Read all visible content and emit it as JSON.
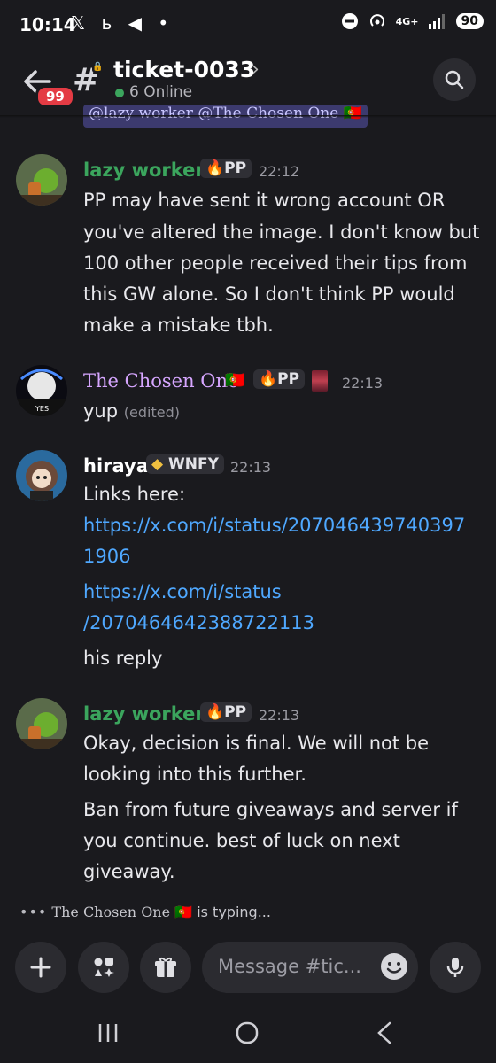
{
  "status_bar": {
    "time": "10:14",
    "left_icons": "𝕏 ь ◀ •",
    "network": "4G+",
    "battery": "90"
  },
  "header": {
    "back_icon": "arrow-left-icon",
    "mention_badge": "99",
    "channel_icon": "hash-lock-icon",
    "title": "ticket-0033",
    "chevron": "›",
    "online": "6 Online",
    "search_icon": "search-icon"
  },
  "previous_snippet": "@lazy worker @The Chosen One 🇵🇹",
  "messages": [
    {
      "author": "lazy worker",
      "author_color": "#3ba55d",
      "tag": "🔥PP",
      "time": "22:12",
      "lines": [
        "PP may have sent it wrong account OR",
        "you've altered the image. I don't know but",
        "100 other people received their tips from",
        "this GW alone. So I don't think PP would",
        "make a mistake tbh."
      ]
    },
    {
      "author": "The Chosen One",
      "author_color": "#d6a6ff",
      "flag": "🇵🇹",
      "tag": "🔥PP",
      "time": "22:13",
      "lines": [
        "yup"
      ],
      "edited": "(edited)"
    },
    {
      "author": "hiraya",
      "author_color": "#ffffff",
      "tag": "WNFY",
      "time": "22:13",
      "lines": [
        "Links here:",
        "https://x.com/i/status/207046439740397",
        "1906",
        "https://x.com/i/status",
        "/2070464642388722113",
        "his reply"
      ]
    },
    {
      "author": "lazy worker",
      "author_color": "#3ba55d",
      "tag": "🔥PP",
      "time": "22:13",
      "lines": [
        "Okay, decision is final. We will not be",
        "looking into this further.",
        "Ban from future giveaways and server if",
        "you continue.  best of luck on next",
        "giveaway."
      ]
    }
  ],
  "typing": {
    "user": "The Chosen One",
    "flag": "🇵🇹",
    "text": "is typing..."
  },
  "composer": {
    "placeholder": "Message #tic...",
    "icons": [
      "plus-icon",
      "apps-icon",
      "gift-icon",
      "emoji-icon",
      "microphone-icon"
    ]
  },
  "nav": [
    "recents-icon",
    "home-icon",
    "back-icon"
  ]
}
